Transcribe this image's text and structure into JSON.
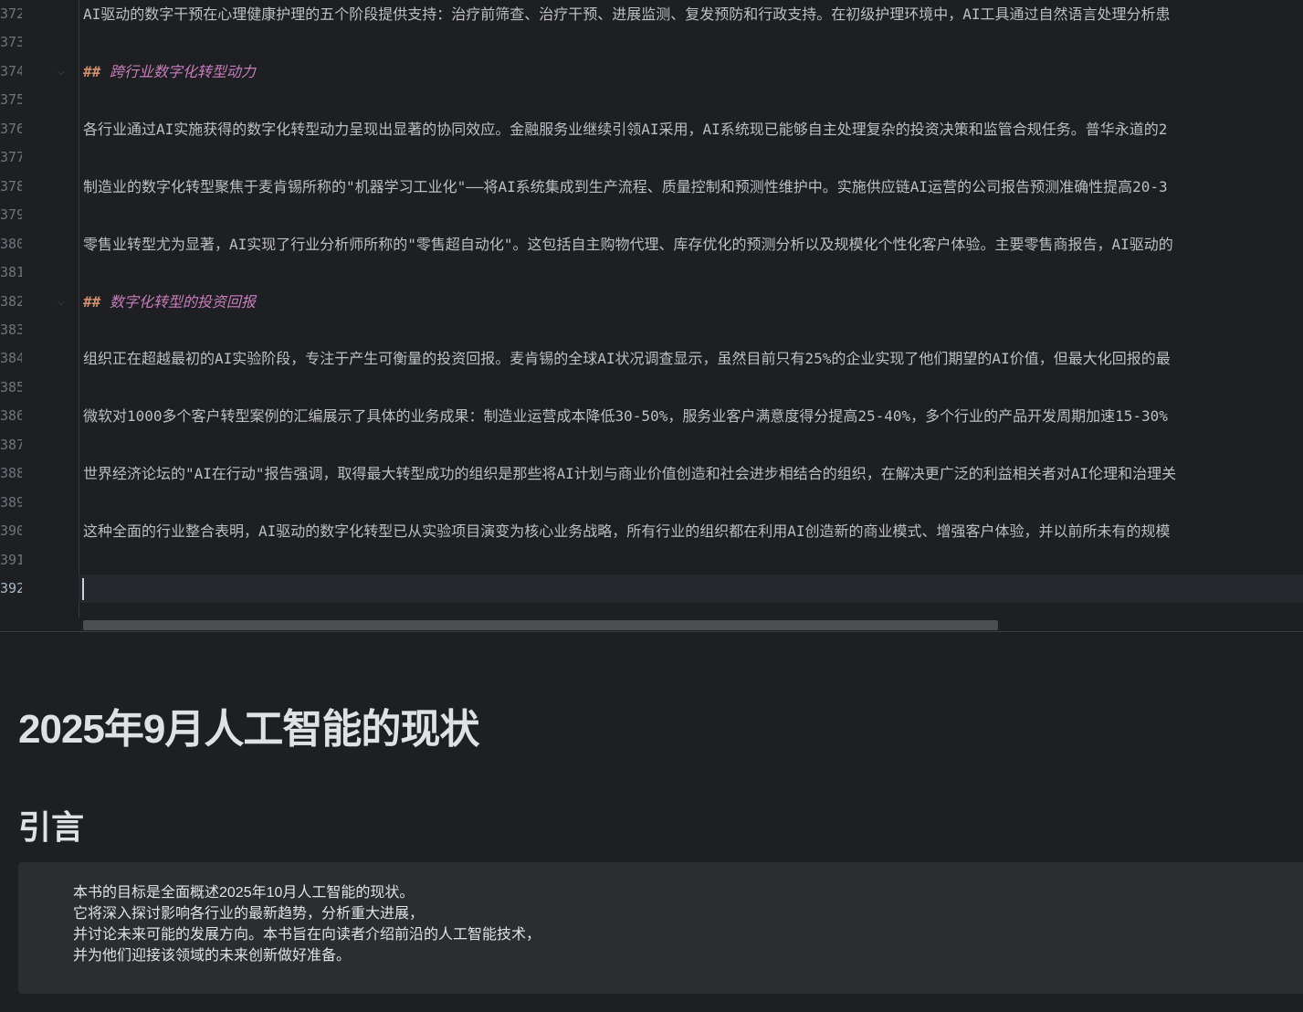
{
  "editor": {
    "lines": [
      {
        "num": "372",
        "text": "AI驱动的数字干预在心理健康护理的五个阶段提供支持：治疗前筛查、治疗干预、进展监测、复发预防和行政支持。在初级护理环境中，AI工具通过自然语言处理分析患"
      },
      {
        "num": "373",
        "text": ""
      },
      {
        "num": "374",
        "hash": "##",
        "heading": "跨行业数字化转型动力"
      },
      {
        "num": "375",
        "text": ""
      },
      {
        "num": "376",
        "text": "各行业通过AI实施获得的数字化转型动力呈现出显著的协同效应。金融服务业继续引领AI采用，AI系统现已能够自主处理复杂的投资决策和监管合规任务。普华永道的2"
      },
      {
        "num": "377",
        "text": ""
      },
      {
        "num": "378",
        "text": "制造业的数字化转型聚焦于麦肯锡所称的\"机器学习工业化\"——将AI系统集成到生产流程、质量控制和预测性维护中。实施供应链AI运营的公司报告预测准确性提高20-3"
      },
      {
        "num": "379",
        "text": ""
      },
      {
        "num": "380",
        "text": "零售业转型尤为显著，AI实现了行业分析师所称的\"零售超自动化\"。这包括自主购物代理、库存优化的预测分析以及规模化个性化客户体验。主要零售商报告，AI驱动的"
      },
      {
        "num": "381",
        "text": ""
      },
      {
        "num": "382",
        "hash": "##",
        "heading": "数字化转型的投资回报"
      },
      {
        "num": "383",
        "text": ""
      },
      {
        "num": "384",
        "text": "组织正在超越最初的AI实验阶段，专注于产生可衡量的投资回报。麦肯锡的全球AI状况调查显示，虽然目前只有25%的企业实现了他们期望的AI价值，但最大化回报的最"
      },
      {
        "num": "385",
        "text": ""
      },
      {
        "num": "386",
        "text": "微软对1000多个客户转型案例的汇编展示了具体的业务成果：制造业运营成本降低30-50%，服务业客户满意度得分提高25-40%，多个行业的产品开发周期加速15-30%"
      },
      {
        "num": "387",
        "text": ""
      },
      {
        "num": "388",
        "text": "世界经济论坛的\"AI在行动\"报告强调，取得最大转型成功的组织是那些将AI计划与商业价值创造和社会进步相结合的组织，在解决更广泛的利益相关者对AI伦理和治理关"
      },
      {
        "num": "389",
        "text": ""
      },
      {
        "num": "390",
        "text": "这种全面的行业整合表明，AI驱动的数字化转型已从实验项目演变为核心业务战略，所有行业的组织都在利用AI创造新的商业模式、增强客户体验，并以前所未有的规模"
      },
      {
        "num": "391",
        "text": ""
      },
      {
        "num": "392",
        "text": ""
      }
    ]
  },
  "preview": {
    "title": "2025年9月人工智能的现状",
    "section_heading": "引言",
    "quote_lines": [
      "本书的目标是全面概述2025年10月人工智能的现状。",
      "它将深入探讨影响各行业的最新趋势，分析重大进展，",
      "并讨论未来可能的发展方向。本书旨在向读者介绍前沿的人工智能技术，",
      "并为他们迎接该领域的未来创新做好准备。"
    ]
  }
}
